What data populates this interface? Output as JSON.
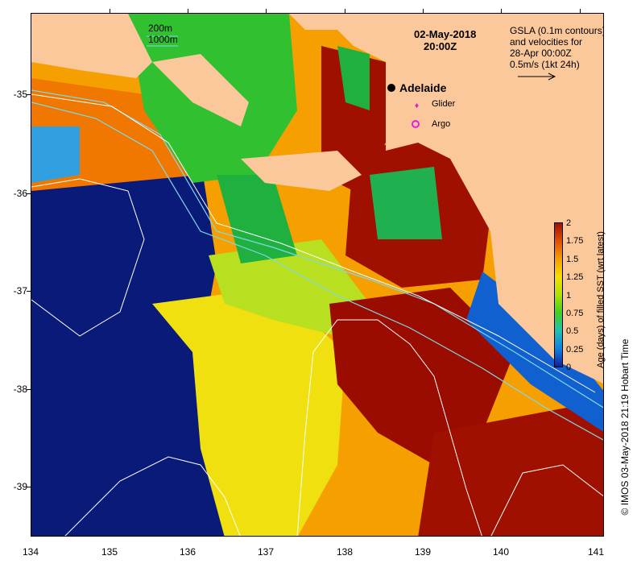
{
  "map": {
    "date": "02-May-2018",
    "time": "20:00Z",
    "legend_gsla_line1": "GSLA (0.1m contours)",
    "legend_gsla_line2": "and velocities for",
    "legend_gsla_line3": "28-Apr 00:00Z",
    "legend_gsla_line4": "0.5m/s (1kt 24h)",
    "contour_200": "200m",
    "contour_1000": "1000m",
    "city": "Adelaide",
    "glider_label": "Glider",
    "argo_label": "Argo",
    "credit": "© IMOS 03-May-2018 21:19 Hobart Time",
    "land_color": "#fbc89c",
    "contour_color": "#7fd8e8"
  },
  "axes": {
    "x_ticks": [
      "134",
      "135",
      "136",
      "137",
      "138",
      "139",
      "140",
      "141"
    ],
    "y_ticks": [
      "-35",
      "-36",
      "-37",
      "-38",
      "-39"
    ]
  },
  "colorbar": {
    "title": "Age (days) of filled SST (wrt latest)",
    "ticks": [
      "2",
      "1.75",
      "1.5",
      "1.25",
      "1",
      "0.75",
      "0.5",
      "0.25",
      "0"
    ],
    "colors": [
      "#a01000",
      "#e05000",
      "#f5a000",
      "#f5e000",
      "#b0e000",
      "#40d020",
      "#20c0b0",
      "#1080e0",
      "#1020a0"
    ]
  }
}
